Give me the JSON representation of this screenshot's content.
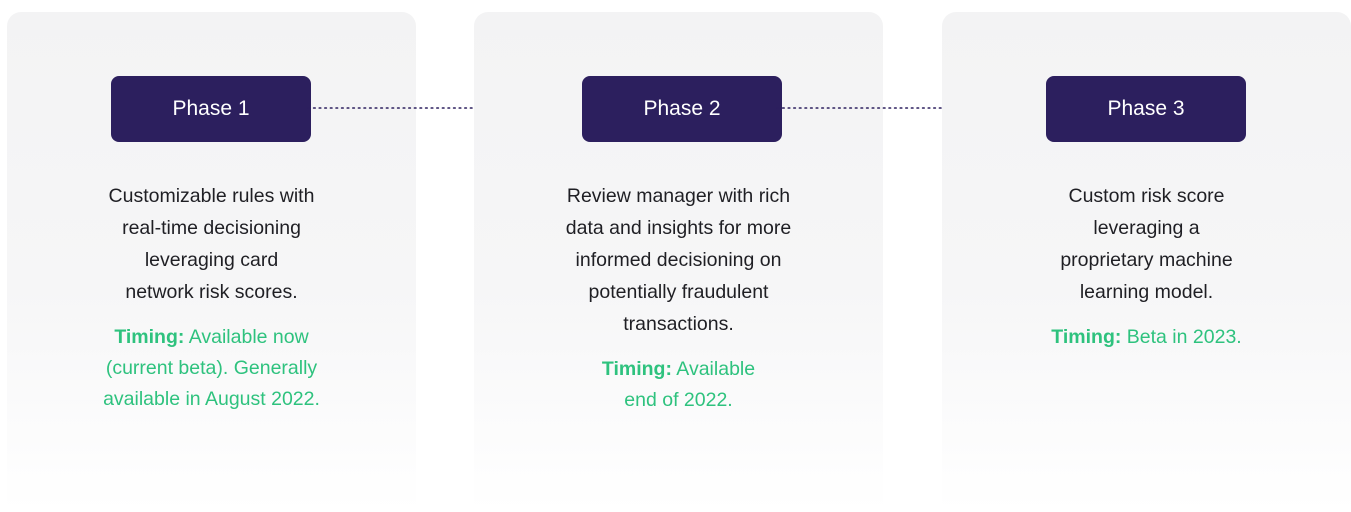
{
  "phases": [
    {
      "label": "Phase 1",
      "description_lines": [
        "Customizable rules with",
        "real-time decisioning",
        "leveraging card",
        "network risk scores."
      ],
      "timing_label": "Timing:",
      "timing_lines": [
        " Available now",
        "(current beta). Generally",
        "available in August 2022."
      ]
    },
    {
      "label": "Phase 2",
      "description_lines": [
        "Review manager with rich",
        "data and insights for more",
        "informed decisioning on",
        "potentially fraudulent",
        "transactions."
      ],
      "timing_label": "Timing:",
      "timing_lines": [
        " Available",
        "end of 2022."
      ]
    },
    {
      "label": "Phase 3",
      "description_lines": [
        "Custom risk score",
        "leveraging a",
        "proprietary machine",
        "learning model."
      ],
      "timing_label": "Timing:",
      "timing_lines": [
        " Beta in 2023."
      ]
    }
  ],
  "colors": {
    "phase_button": "#2c1f5e",
    "timing_text": "#2ec27e",
    "card_background": "#f3f3f4",
    "connector": "#2c1f5e"
  },
  "icons": {
    "connector": "dotted-arrow-icon"
  }
}
